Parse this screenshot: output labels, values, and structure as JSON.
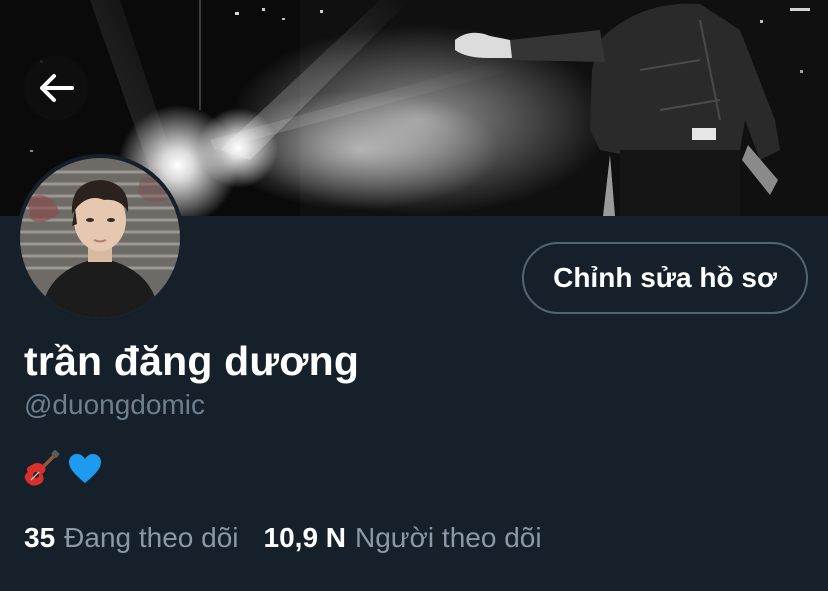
{
  "header": {
    "back_icon": "arrow-left-icon",
    "banner": "banner-photo"
  },
  "profile": {
    "avatar": "avatar-photo",
    "edit_button_label": "Chỉnh sửa hồ sơ",
    "display_name": "trần đăng dương",
    "handle": "@duongdomic",
    "bio_icons": [
      "guitar-icon",
      "blue-heart-icon"
    ]
  },
  "stats": {
    "following_count": "35",
    "following_label": "Đang theo dõi",
    "followers_count": "10,9 N",
    "followers_label": "Người theo dõi"
  },
  "colors": {
    "background": "#15202b",
    "text_primary": "#ffffff",
    "text_secondary": "#8b98a5",
    "button_border": "#536471",
    "heart": "#1d9bf0"
  }
}
